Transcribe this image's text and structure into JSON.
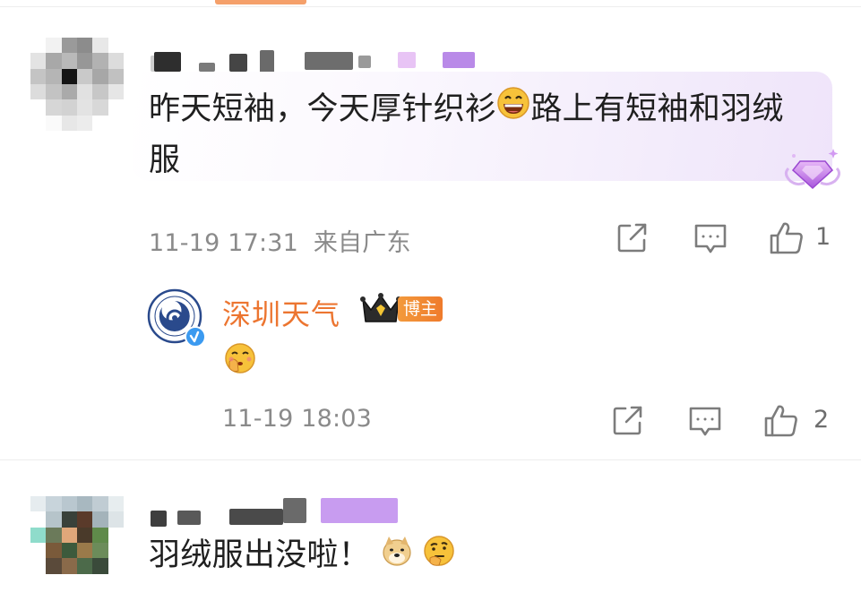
{
  "comment1": {
    "text_line1": "昨天短袖，今天厚针织衫",
    "text_line1b": "路上有短袖和羽绒",
    "text_line2": "服",
    "emoji": "grinning-face-emoji",
    "timestamp": "11-19 17:31",
    "location": "来自广东",
    "like_count": "1"
  },
  "reply": {
    "author": "深圳天气",
    "badge": "博主",
    "emoji": "shushing-face-emoji",
    "timestamp": "11-19 18:03",
    "like_count": "2"
  },
  "comment2": {
    "text": "羽绒服出没啦！",
    "emojis": [
      "doge-emoji",
      "thinking-face-emoji"
    ]
  },
  "icons": {
    "share": "share-icon",
    "comment": "comment-icon",
    "like": "thumbs-up-icon",
    "verified": "verified-badge-icon",
    "crown": "crown-icon",
    "diamond": "diamond-badge-icon"
  },
  "colors": {
    "accent": "#ec7530",
    "verified": "#3b9af0",
    "badge_purple": "#b57be8"
  }
}
